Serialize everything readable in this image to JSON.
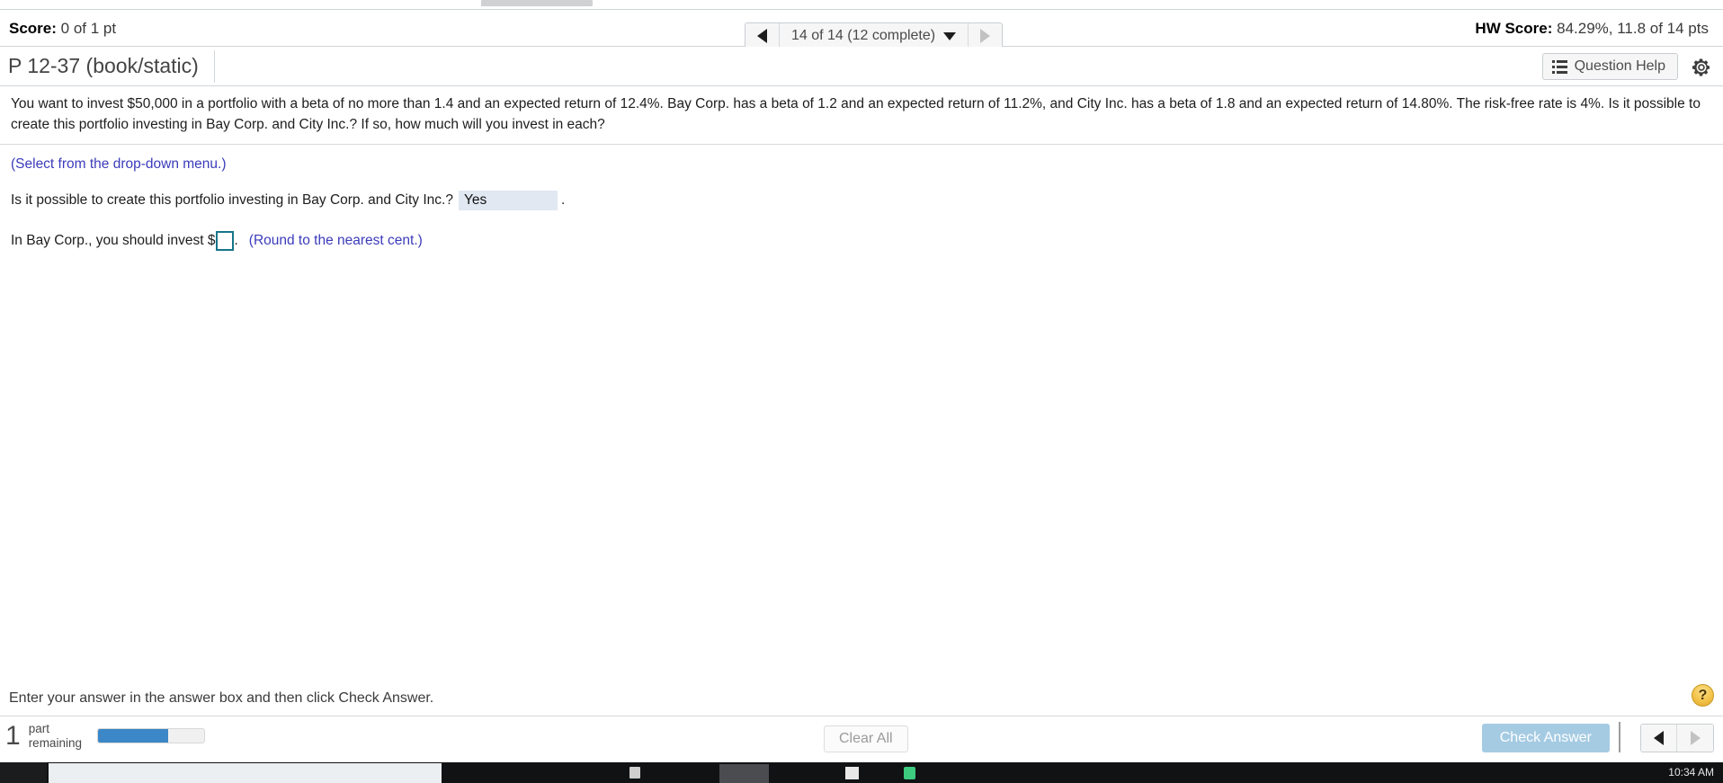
{
  "score_bar": {
    "score_label": "Score:",
    "score_value": "0 of 1 pt",
    "hw_score_label": "HW Score:",
    "hw_score_value": "84.29%, 11.8 of 14 pts",
    "pager": {
      "label": "14 of 14 (12 complete)",
      "prev_icon": "triangle-left-icon",
      "next_icon": "triangle-right-icon",
      "caret_icon": "caret-down-icon"
    }
  },
  "question_header": {
    "title": "P 12-37 (book/static)",
    "question_help_label": "Question Help",
    "question_help_icon": "list-icon",
    "settings_icon": "gear-icon"
  },
  "question": {
    "text": "You want to invest $50,000 in a portfolio with a beta of no more than 1.4 and an expected return of 12.4%. Bay Corp. has a beta of 1.2 and an expected return of 11.2%, and City Inc. has a beta of 1.8 and an expected return of 14.80%. The risk-free rate is 4%. Is it possible to create this portfolio investing in Bay Corp. and City Inc.? If so, how much will you invest in each?",
    "hint": "(Select from the drop-down menu.)",
    "part1_prompt": "Is it possible to create this portfolio investing in Bay Corp. and City Inc.?",
    "part1_answer": "Yes",
    "part1_trailing": ".",
    "part2_prompt": "In Bay Corp., you should invest $",
    "part2_value": "",
    "part2_placeholder": "",
    "part2_trailing": ".",
    "part2_note": "(Round to the nearest cent.)"
  },
  "footer": {
    "instruction": "Enter your answer in the answer box and then click Check Answer.",
    "help_icon_label": "?",
    "parts_count": "1",
    "parts_label_line1": "part",
    "parts_label_line2": "remaining",
    "progress_percent": 66,
    "clear_all_label": "Clear All",
    "check_answer_label": "Check Answer",
    "prev_icon": "triangle-left-icon",
    "next_icon": "triangle-right-icon"
  },
  "taskbar": {
    "clock": "10:34 AM"
  },
  "colors": {
    "accent_blue": "#3b87c8",
    "check_answer_bg": "#a5cbe3",
    "dropdown_bg": "#e1e8f2",
    "input_border": "#17758a",
    "link_blue": "#3b3bbb",
    "help_gold": "#f3c34a"
  }
}
